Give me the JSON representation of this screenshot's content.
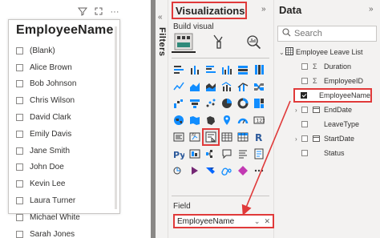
{
  "slicer": {
    "title": "EmployeeName",
    "items": [
      "(Blank)",
      "Alice Brown",
      "Bob Johnson",
      "Chris Wilson",
      "David Clark",
      "Emily Davis",
      "Jane Smith",
      "John Doe",
      "Kevin Lee",
      "Laura Turner",
      "Michael White",
      "Sarah Jones"
    ]
  },
  "filters": {
    "label": "Filters"
  },
  "visualizations": {
    "title": "Visualizations",
    "build_label": "Build visual",
    "field_label": "Field",
    "field_value": "EmployeeName",
    "highlighted_visual": "slicer-icon"
  },
  "data_pane": {
    "title": "Data",
    "search_placeholder": "Search",
    "table_name": "Employee Leave List",
    "fields": [
      {
        "name": "Duration",
        "kind": "sum",
        "checked": false
      },
      {
        "name": "EmployeeID",
        "kind": "sum",
        "checked": false
      },
      {
        "name": "EmployeeName",
        "kind": "text",
        "checked": true
      },
      {
        "name": "EndDate",
        "kind": "date",
        "checked": false
      },
      {
        "name": "LeaveType",
        "kind": "text",
        "checked": false
      },
      {
        "name": "StartDate",
        "kind": "date",
        "checked": false
      },
      {
        "name": "Status",
        "kind": "text",
        "checked": false
      }
    ]
  },
  "colors": {
    "highlight": "#e03a3a",
    "accent": "#118dff"
  }
}
